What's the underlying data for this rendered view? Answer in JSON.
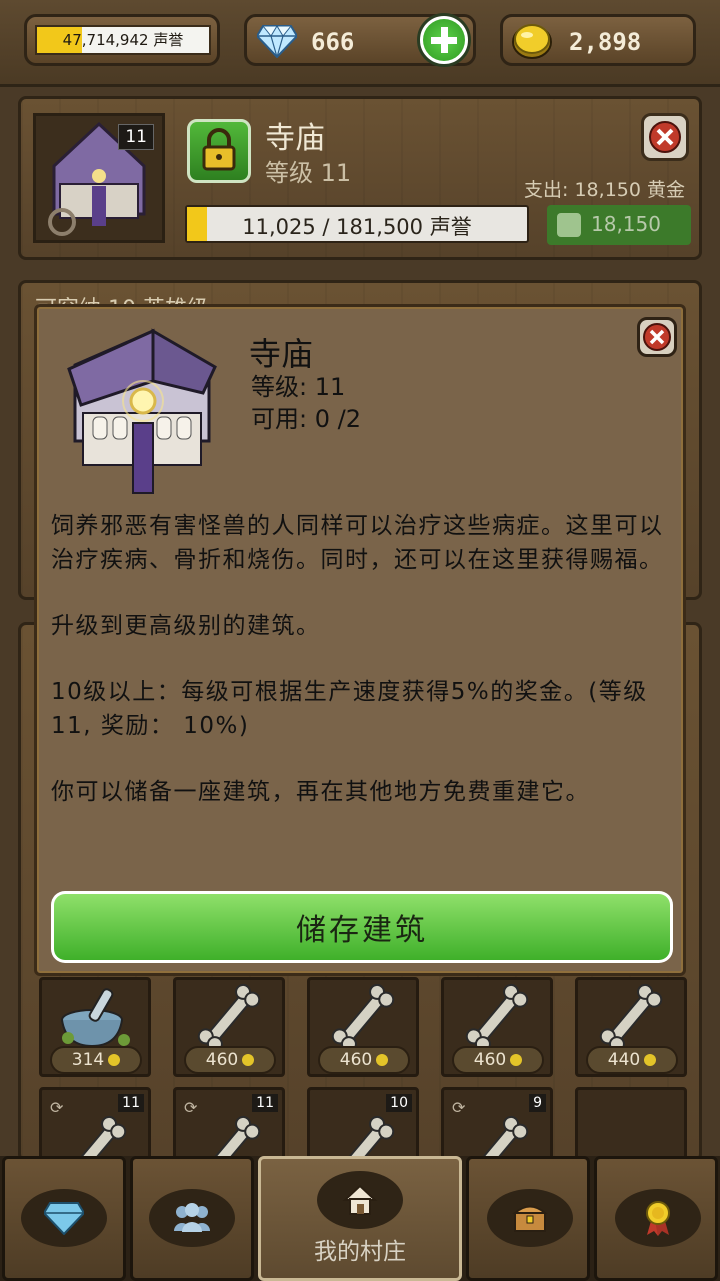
{
  "topbar": {
    "reputation": {
      "value": "47,714,942 声誉",
      "fill": 0.26
    },
    "gems": {
      "value": "666"
    },
    "gold": {
      "value": "2,898"
    }
  },
  "building": {
    "level_badge": "11",
    "name": "寺庙",
    "level": "等级 11",
    "cost": "支出: 18,150 黄金",
    "progress": {
      "text": "11,025 / 181,500 声誉",
      "fraction": 0.06
    },
    "buy_label": "18,150"
  },
  "background_panel": {
    "title": "可容纳 10 英雄级"
  },
  "slots": [
    {
      "price": "314",
      "item": "mortar-pestle"
    },
    {
      "price": "460",
      "item": "bone"
    },
    {
      "price": "460",
      "item": "bone"
    },
    {
      "price": "460",
      "item": "bone"
    },
    {
      "price": "440",
      "item": "bone"
    }
  ],
  "slot_levels": [
    "11",
    "11",
    "10",
    "9"
  ],
  "modal": {
    "name": "寺庙",
    "level": "等级: 11",
    "available": "可用: 0 /2",
    "desc1": "饲养邪恶有害怪兽的人同样可以治疗这些病症。这里可以治疗疾病、骨折和烧伤。同时，还可以在这里获得赐福。",
    "desc2": "升级到更高级别的建筑。",
    "desc3": "10级以上：每级可根据生产速度获得5%的奖金。(等级 11, 奖励： 10%)",
    "desc4": "你可以储备一座建筑，再在其他地方免费重建它。",
    "store_button": "储存建筑"
  },
  "nav": {
    "home_label": "我的村庄",
    "icons": [
      "gem-icon",
      "people-icon",
      "home-icon",
      "chest-icon",
      "medal-icon"
    ]
  },
  "colors": {
    "accent_green": "#3fb02a",
    "gold_bar": "#f2c81a",
    "wood": "#5e4a30"
  }
}
